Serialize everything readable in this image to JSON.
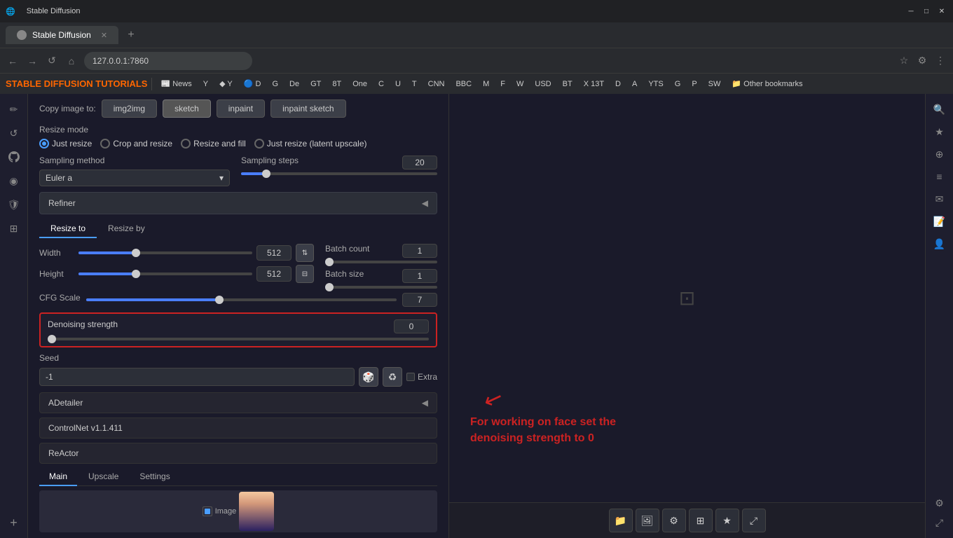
{
  "browser": {
    "title": "Stable Diffusion",
    "url": "127.0.0.1:7860",
    "tab_label": "Stable Diffusion",
    "window_controls": [
      "minimize",
      "maximize",
      "close"
    ],
    "bookmarks": [
      "News",
      "Y",
      "Y",
      "D",
      "G",
      "De",
      "GT",
      "8T",
      "One",
      "C",
      "U",
      "T",
      "CNN",
      "BBC",
      "M",
      "F",
      "W",
      "USD",
      "BT",
      "X 13T",
      "D",
      "A",
      "YTS",
      "G",
      "P",
      "SW",
      "Other bookmarks"
    ]
  },
  "left_sidebar": {
    "icons": [
      "home",
      "star",
      "github",
      "circle",
      "shield",
      "layers",
      "plus"
    ]
  },
  "main": {
    "brand": "STABLE DIFFUSION TUTORIALS",
    "copy_image": {
      "label": "Copy image to:",
      "buttons": [
        "img2img",
        "sketch",
        "inpaint",
        "inpaint sketch"
      ]
    },
    "resize_mode": {
      "label": "Resize mode",
      "options": [
        "Just resize",
        "Crop and resize",
        "Resize and fill",
        "Just resize (latent upscale)"
      ],
      "selected": "Just resize"
    },
    "sampling_method": {
      "label": "Sampling method",
      "value": "Euler a"
    },
    "sampling_steps": {
      "label": "Sampling steps",
      "value": 20,
      "min": 1,
      "max": 150,
      "fill_pct": 13
    },
    "refiner": {
      "label": "Refiner"
    },
    "resize_tabs": [
      "Resize to",
      "Resize by"
    ],
    "width": {
      "label": "Width",
      "value": 512,
      "fill_pct": 33
    },
    "height": {
      "label": "Height",
      "value": 512,
      "fill_pct": 33
    },
    "batch_count": {
      "label": "Batch count",
      "value": 1,
      "fill_pct": 1
    },
    "batch_size": {
      "label": "Batch size",
      "value": 1,
      "fill_pct": 1
    },
    "cfg_scale": {
      "label": "CFG Scale",
      "value": 7,
      "fill_pct": 43
    },
    "denoising_strength": {
      "label": "Denoising strength",
      "value": 0,
      "fill_pct": 0,
      "highlighted": true
    },
    "seed": {
      "label": "Seed",
      "value": "-1"
    },
    "adetailer": {
      "label": "ADetailer"
    },
    "controlnet": {
      "label": "ControlNet v1.1.411"
    },
    "reactor": {
      "label": "ReActor",
      "tabs": [
        "Main",
        "Upscale",
        "Settings"
      ]
    }
  },
  "annotation": {
    "text": "For working on face set the denoising strength to 0",
    "arrow": "↙"
  },
  "right_toolbar": {
    "icons": [
      "folder",
      "image",
      "sliders",
      "layers",
      "star",
      "resize"
    ]
  }
}
